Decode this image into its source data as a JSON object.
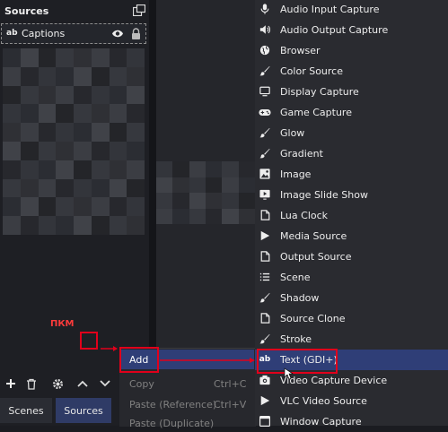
{
  "dock": {
    "title": "Sources",
    "item": {
      "badge": "ab",
      "label": "Captions"
    }
  },
  "tabs": {
    "scenes": "Scenes",
    "sources": "Sources"
  },
  "context_menu": {
    "add": "Add",
    "items": [
      {
        "label": "Copy",
        "shortcut": "Ctrl+C"
      },
      {
        "label": "Paste (Reference)",
        "shortcut": "Ctrl+V"
      },
      {
        "label": "Paste (Duplicate)",
        "shortcut": ""
      }
    ]
  },
  "submenu": {
    "items": [
      {
        "label": "Audio Input Capture",
        "icon": "microphone-icon"
      },
      {
        "label": "Audio Output Capture",
        "icon": "speaker-icon"
      },
      {
        "label": "Browser",
        "icon": "globe-icon"
      },
      {
        "label": "Color Source",
        "icon": "brush-icon"
      },
      {
        "label": "Display Capture",
        "icon": "monitor-icon"
      },
      {
        "label": "Game Capture",
        "icon": "gamepad-icon"
      },
      {
        "label": "Glow",
        "icon": "brush-icon"
      },
      {
        "label": "Gradient",
        "icon": "brush-icon"
      },
      {
        "label": "Image",
        "icon": "image-icon"
      },
      {
        "label": "Image Slide Show",
        "icon": "slideshow-icon"
      },
      {
        "label": "Lua Clock",
        "icon": "file-icon"
      },
      {
        "label": "Media Source",
        "icon": "play-icon"
      },
      {
        "label": "Output Source",
        "icon": "file-icon"
      },
      {
        "label": "Scene",
        "icon": "list-icon"
      },
      {
        "label": "Shadow",
        "icon": "brush-icon"
      },
      {
        "label": "Source Clone",
        "icon": "file-icon"
      },
      {
        "label": "Stroke",
        "icon": "brush-icon"
      },
      {
        "label": "Text (GDI+)",
        "icon": "text-icon",
        "highlighted": true
      },
      {
        "label": "Video Capture Device",
        "icon": "camera-icon"
      },
      {
        "label": "VLC Video Source",
        "icon": "play-icon"
      },
      {
        "label": "Window Capture",
        "icon": "window-icon"
      }
    ]
  },
  "annotation": {
    "label": "ПКМ",
    "color": "#e0001b"
  },
  "colors": {
    "accent": "#2f3e77",
    "annotation": "#e0001b"
  }
}
